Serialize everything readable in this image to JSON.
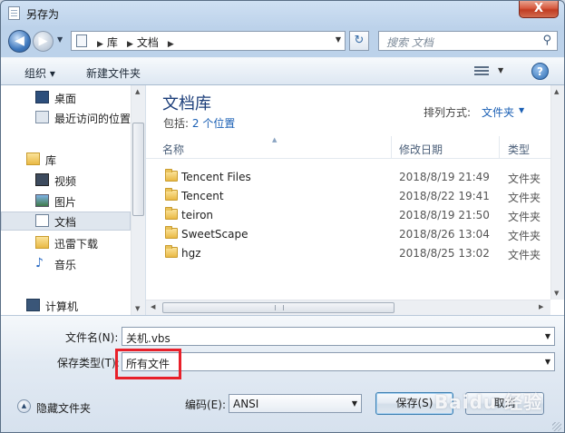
{
  "window": {
    "title": "另存为",
    "close_glyph": "X"
  },
  "address": {
    "crumbs": [
      "库",
      "文档"
    ],
    "search_placeholder": "搜索 文档"
  },
  "toolbar": {
    "organize": "组织 ▾",
    "new_folder": "新建文件夹",
    "help": "?"
  },
  "nav": {
    "items": [
      {
        "label": "桌面",
        "icon": "desktop-icon"
      },
      {
        "label": "最近访问的位置",
        "icon": "recent-places-icon"
      },
      {
        "label": "库",
        "icon": "library-icon"
      },
      {
        "label": "视频",
        "icon": "video-icon"
      },
      {
        "label": "图片",
        "icon": "picture-icon"
      },
      {
        "label": "文档",
        "icon": "document-icon"
      },
      {
        "label": "迅雷下载",
        "icon": "download-folder-icon"
      },
      {
        "label": "音乐",
        "icon": "music-icon"
      },
      {
        "label": "计算机",
        "icon": "computer-icon"
      }
    ]
  },
  "library": {
    "title": "文档库",
    "includes_label": "包括:",
    "includes_value": "2 个位置",
    "arrange_label": "排列方式:",
    "arrange_value": "文件夹"
  },
  "columns": {
    "name": "名称",
    "date": "修改日期",
    "type": "类型"
  },
  "files": [
    {
      "name": "Tencent Files",
      "date": "2018/8/19 21:49",
      "type": "文件夹"
    },
    {
      "name": "Tencent",
      "date": "2018/8/22 19:41",
      "type": "文件夹"
    },
    {
      "name": "teiron",
      "date": "2018/8/19 21:50",
      "type": "文件夹"
    },
    {
      "name": "SweetScape",
      "date": "2018/8/26 13:04",
      "type": "文件夹"
    },
    {
      "name": "hgz",
      "date": "2018/8/25 13:02",
      "type": "文件夹"
    }
  ],
  "form": {
    "filename_label": "文件名(N):",
    "filename_value": "关机.vbs",
    "filetype_label": "保存类型(T):",
    "filetype_value": "所有文件",
    "encoding_label": "编码(E):",
    "encoding_value": "ANSI",
    "hide_folders": "隐藏文件夹",
    "save": "保存(S)",
    "cancel": "取消"
  },
  "watermark": "Baidu 经验",
  "colors": {
    "highlight": "#e8202a",
    "library_title": "#1c3e7a",
    "link": "#1a5fb4"
  }
}
